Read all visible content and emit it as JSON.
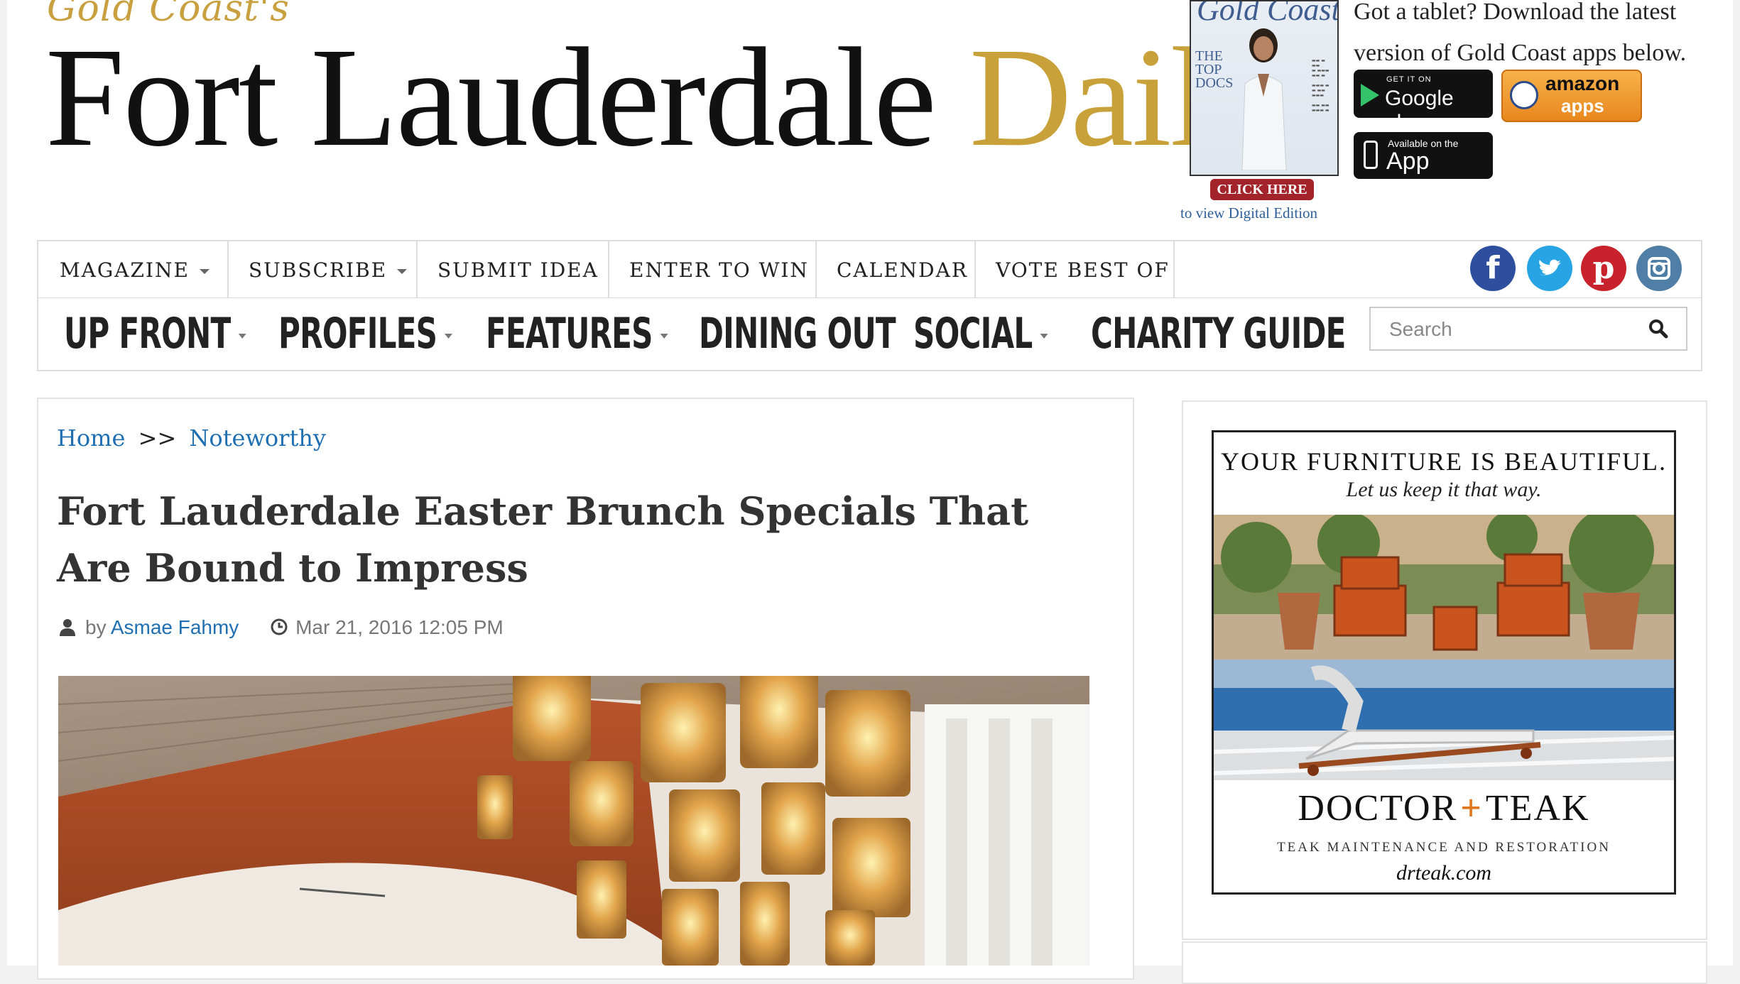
{
  "header": {
    "kicker": "Gold Coast's",
    "masthead_main": "Fort Lauderdale",
    "masthead_accent": "Daily",
    "cover": {
      "title": "Gold Coast",
      "headline_lines": [
        "THE",
        "TOP",
        "DOCS"
      ],
      "click_label": "CLICK HERE",
      "digital_link": "to view Digital Edition"
    },
    "apps": {
      "text": "Got a tablet? Download the latest version of Gold Coast apps below.",
      "google_small": "GET IT ON",
      "google_big": "Google play",
      "amazon_top": "amazon",
      "amazon_bottom": "apps",
      "apple_small": "Available on the",
      "apple_big": "App Store"
    }
  },
  "topnav": {
    "items": [
      {
        "label": "MAGAZINE",
        "dropdown": true
      },
      {
        "label": "SUBSCRIBE",
        "dropdown": true
      },
      {
        "label": "SUBMIT IDEA",
        "dropdown": false
      },
      {
        "label": "ENTER TO WIN",
        "dropdown": false
      },
      {
        "label": "CALENDAR",
        "dropdown": false
      },
      {
        "label": "VOTE BEST OF",
        "dropdown": false
      }
    ],
    "social": [
      {
        "icon": "facebook-icon",
        "glyph": "f",
        "color": "#2d4f9e"
      },
      {
        "icon": "twitter-icon",
        "glyph": "t",
        "color": "#27a4e4"
      },
      {
        "icon": "pinterest-icon",
        "glyph": "p",
        "color": "#c8232c"
      },
      {
        "icon": "instagram-icon",
        "glyph": "◎",
        "color": "#4f7fa6"
      }
    ]
  },
  "secnav": {
    "items": [
      {
        "label": "UP FRONT",
        "dropdown": true
      },
      {
        "label": "PROFILES",
        "dropdown": true
      },
      {
        "label": "FEATURES",
        "dropdown": true
      },
      {
        "label": "DINING OUT",
        "dropdown": false
      },
      {
        "label": "SOCIAL",
        "dropdown": true
      },
      {
        "label": "CHARITY GUIDE",
        "dropdown": false
      }
    ],
    "search_placeholder": "Search"
  },
  "article": {
    "breadcrumb": {
      "home": "Home",
      "sep": ">>",
      "section": "Noteworthy"
    },
    "headline": "Fort Lauderdale Easter Brunch Specials That Are Bound to Impress",
    "by": "by",
    "author": "Asmae Fahmy",
    "date": "Mar 21, 2016 12:05 PM"
  },
  "sidebar": {
    "ad": {
      "headline": "YOUR FURNITURE IS BEAUTIFUL.",
      "subhead": "Let us keep it that way.",
      "brand_left": "DOCTOR",
      "brand_right": "TEAK",
      "tagline": "TEAK MAINTENANCE AND RESTORATION",
      "url": "drteak.com"
    }
  },
  "colors": {
    "accent_gold": "#c9a13a",
    "link_blue": "#1f6fb2",
    "cta_red": "#a3232a"
  }
}
